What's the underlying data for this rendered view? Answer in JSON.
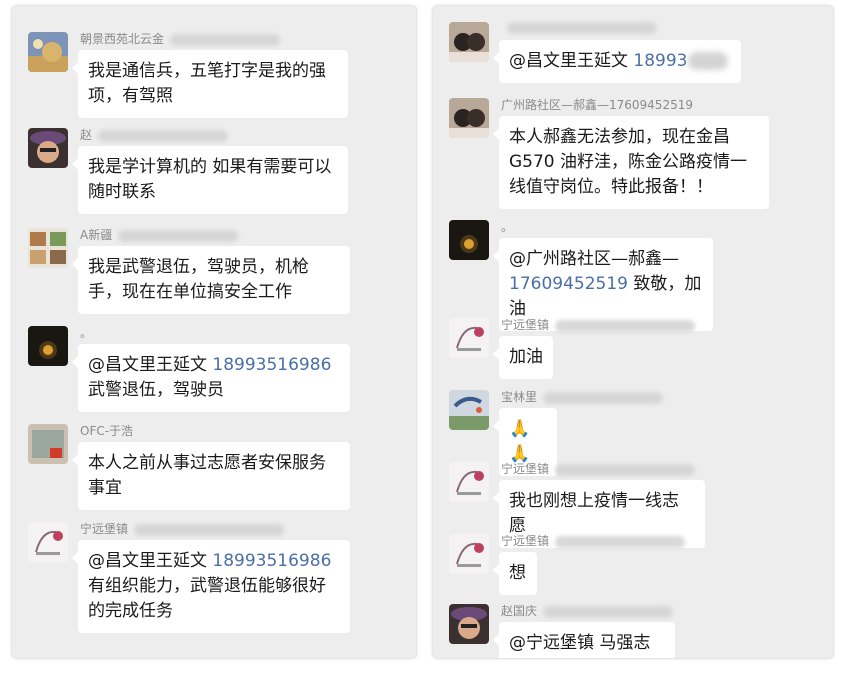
{
  "left": {
    "messages": [
      {
        "sender": "朝景西苑北云金",
        "text": "我是通信兵，五笔打字是我的强项，有驾照"
      },
      {
        "sender": "赵",
        "text": "我是学计算机的 如果有需要可以随时联系"
      },
      {
        "sender": "A新疆",
        "text": "我是武警退伍，驾驶员，机枪手，现在在单位搞安全工作"
      },
      {
        "sender": "。",
        "mention": "@昌文里王延文",
        "phone": "18993516986",
        "rest": "武警退伍，驾驶员"
      },
      {
        "sender": "OFC-于浩",
        "text": "本人之前从事过志愿者安保服务事宜"
      },
      {
        "sender": "宁远堡镇",
        "mention": "@昌文里王延文",
        "phone": "18993516986",
        "rest": "有组织能力，武警退伍能够很好的完成任务"
      }
    ]
  },
  "right": {
    "messages": [
      {
        "sender": "",
        "mention": "@昌文里王延文",
        "phone": "18993"
      },
      {
        "sender": "广州路社区—郝鑫—17609452519",
        "text": "本人郝鑫无法参加，现在金昌G570 油籽洼，陈金公路疫情一线值守岗位。特此报备！！"
      },
      {
        "sender": "。",
        "mention": "@广州路社区—郝鑫—",
        "phone": "17609452519",
        "rest": "致敬，加油"
      },
      {
        "sender": "宁远堡镇",
        "text": "加油"
      },
      {
        "sender": "宝林里",
        "text": "🙏🙏"
      },
      {
        "sender": "宁远堡镇",
        "text": "我也刚想上疫情一线志愿"
      },
      {
        "sender": "宁远堡镇",
        "text": "想"
      },
      {
        "sender": "赵国庆",
        "text": "@宁远堡镇 马强志"
      }
    ]
  },
  "colors": {
    "panel_bg": "#ededed",
    "bubble_bg": "#ffffff",
    "phone_link": "#4a6fa5",
    "sender_text": "#8a8a8a"
  }
}
